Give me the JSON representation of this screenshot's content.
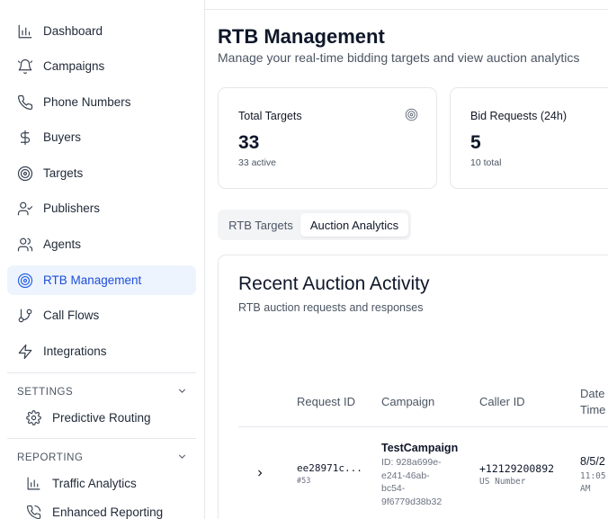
{
  "sidebar": {
    "items": [
      {
        "label": "Dashboard",
        "icon": "bar-chart-icon"
      },
      {
        "label": "Campaigns",
        "icon": "bell-icon"
      },
      {
        "label": "Phone Numbers",
        "icon": "phone-icon"
      },
      {
        "label": "Buyers",
        "icon": "dollar-icon"
      },
      {
        "label": "Targets",
        "icon": "target-icon"
      },
      {
        "label": "Publishers",
        "icon": "user-check-icon"
      },
      {
        "label": "Agents",
        "icon": "users-icon"
      },
      {
        "label": "RTB Management",
        "icon": "radar-icon",
        "active": true
      },
      {
        "label": "Call Flows",
        "icon": "git-branch-icon"
      },
      {
        "label": "Integrations",
        "icon": "zap-icon"
      }
    ],
    "settings": {
      "title": "SETTINGS",
      "items": [
        {
          "label": "Predictive Routing"
        }
      ]
    },
    "reporting": {
      "title": "REPORTING",
      "items": [
        {
          "label": "Traffic Analytics"
        },
        {
          "label": "Enhanced Reporting"
        }
      ]
    }
  },
  "header": {
    "title": "RTB Management",
    "subtitle": "Manage your real-time bidding targets and view auction analytics"
  },
  "cards": [
    {
      "label": "Total Targets",
      "value": "33",
      "meta": "33 active"
    },
    {
      "label": "Bid Requests (24h)",
      "value": "5",
      "meta": "10 total"
    }
  ],
  "tabs": [
    {
      "label": "RTB Targets",
      "active": false
    },
    {
      "label": "Auction Analytics",
      "active": true
    }
  ],
  "panel": {
    "title": "Recent Auction Activity",
    "subtitle": "RTB auction requests and responses",
    "columns": [
      "Request ID",
      "Campaign",
      "Caller ID",
      "Date &",
      "Time"
    ],
    "rows": [
      {
        "request_id": "ee28971c...",
        "request_num": "#53",
        "campaign": "TestCampaign",
        "campaign_id": [
          "ID: 928a699e-",
          "e241-46ab-",
          "bc54-",
          "9f6779d38b32"
        ],
        "caller_id": "+12129200892",
        "caller_type": "US Number",
        "date": "8/5/2",
        "time": [
          "11:05",
          "AM"
        ]
      }
    ]
  },
  "colors": {
    "accent": "#2563eb",
    "active_bg": "#eef4fd",
    "border": "#e5e7eb"
  }
}
